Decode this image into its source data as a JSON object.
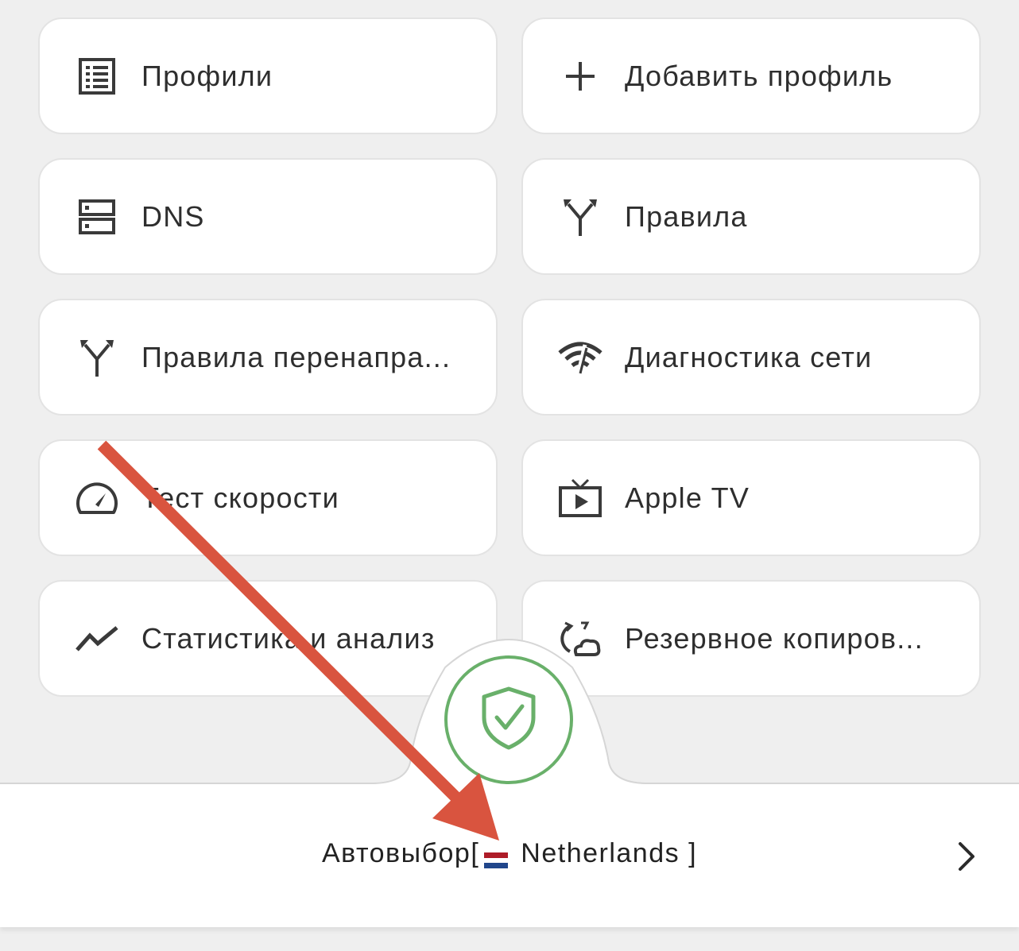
{
  "menu": [
    {
      "label": "Профили",
      "icon": "list-icon"
    },
    {
      "label": "Добавить профиль",
      "icon": "plus-icon"
    },
    {
      "label": "DNS",
      "icon": "server-icon"
    },
    {
      "label": "Правила",
      "icon": "fork-arrows-icon"
    },
    {
      "label": "Правила перенапра...",
      "icon": "fork-arrows-icon"
    },
    {
      "label": "Диагностика сети",
      "icon": "wifi-diagnostic-icon"
    },
    {
      "label": "Тест скорости",
      "icon": "speedometer-icon"
    },
    {
      "label": "Apple TV",
      "icon": "tv-play-icon"
    },
    {
      "label": "Статистика и анализ",
      "icon": "trend-line-icon"
    },
    {
      "label": "Резервное копиров...",
      "icon": "cloud-sync-icon"
    }
  ],
  "connection": {
    "status_icon": "shield-check-icon",
    "status_color": "#69b06a"
  },
  "server": {
    "prefix": "Автовыбор[",
    "flag": "netherlands-flag-icon",
    "name": "Netherlands ]"
  },
  "annotation": {
    "arrow_color": "#d9543f"
  }
}
